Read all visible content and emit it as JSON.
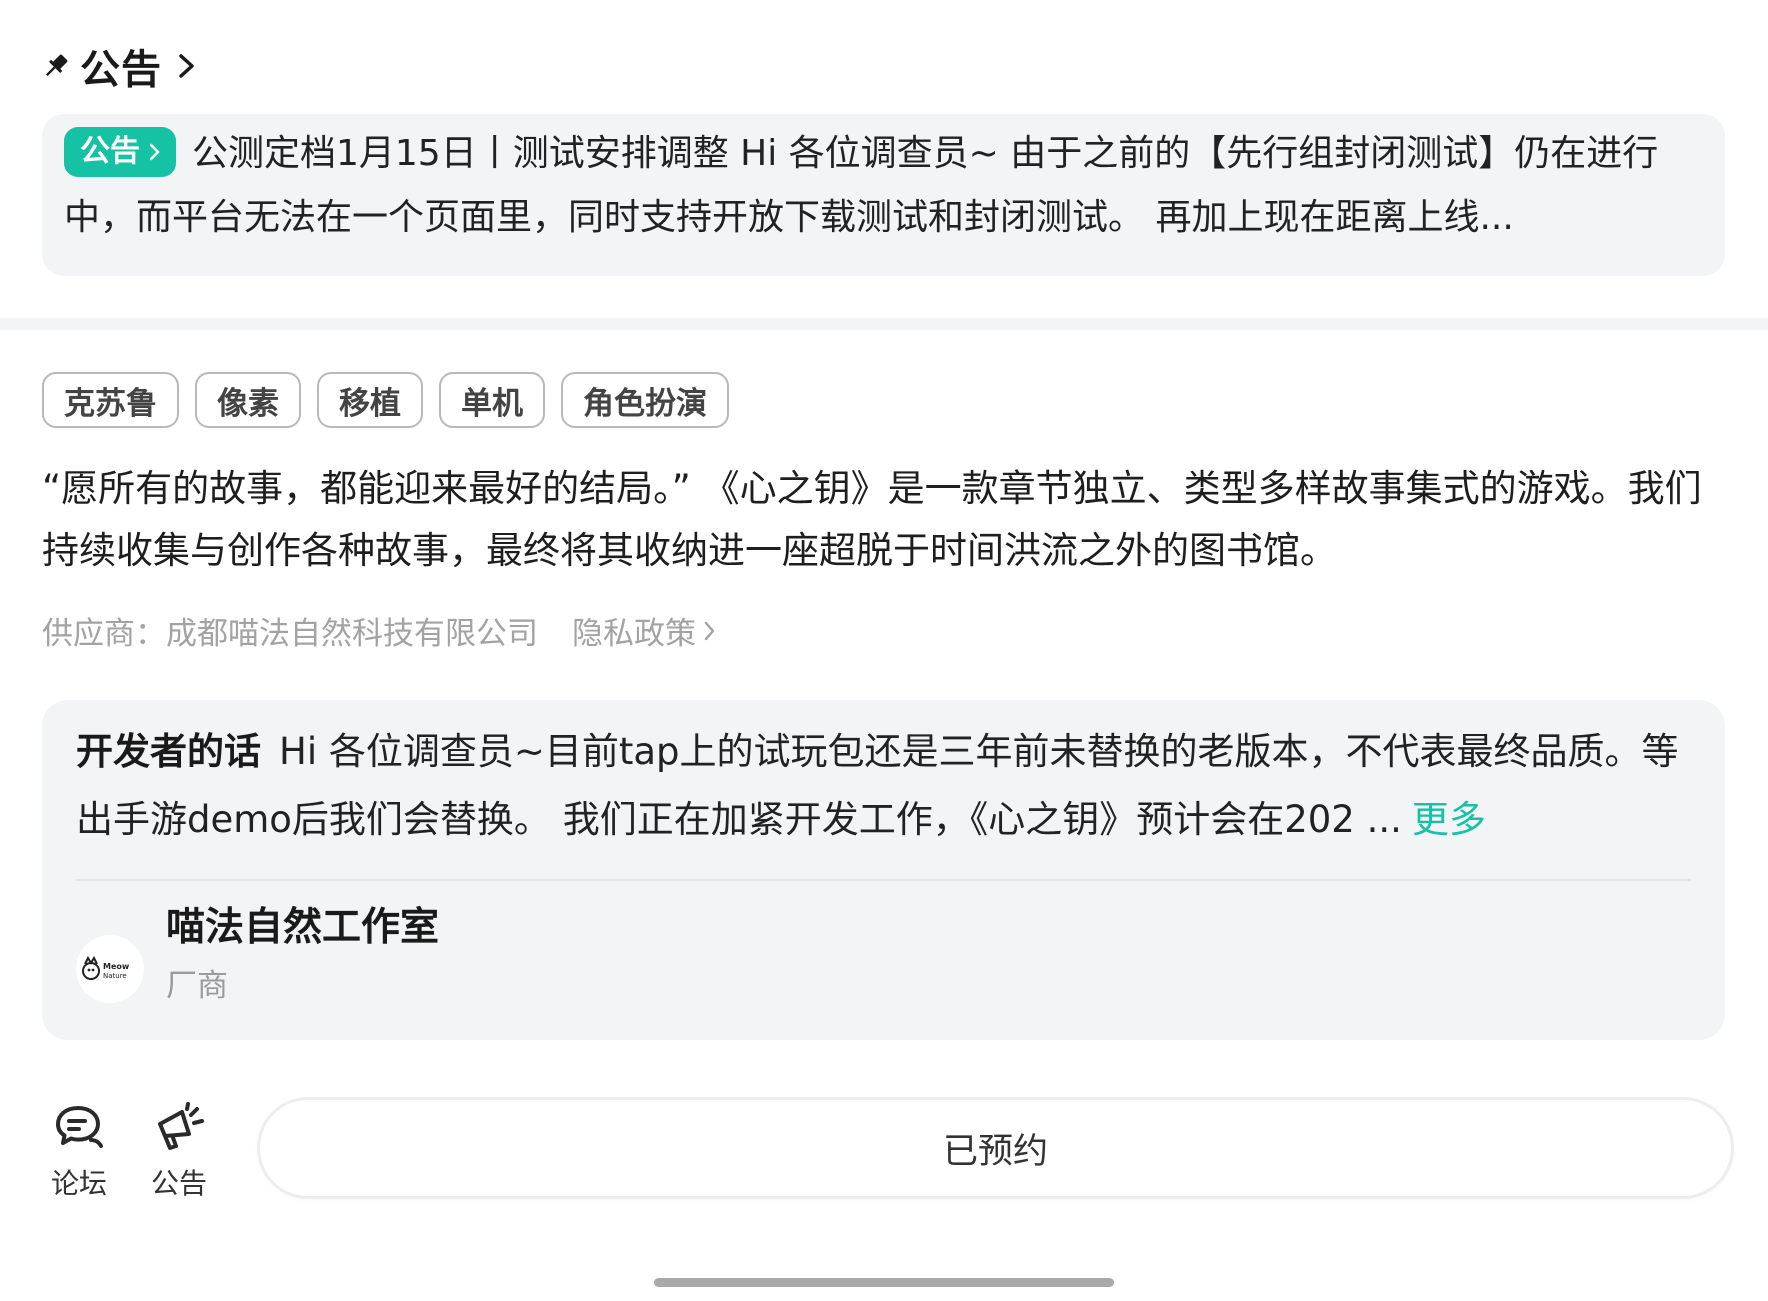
{
  "announcement": {
    "section_title": "公告",
    "badge_label": "公告",
    "text": "公测定档1月15日丨测试安排调整 Hi 各位调查员~ 由于之前的【先行组封闭测试】仍在进行中，而平台无法在一个页面里，同时支持开放下载测试和封闭测试。 再加上现在距离上线...",
    "badge_color": "#16c2a4"
  },
  "tags": [
    "克苏鲁",
    "像素",
    "移植",
    "单机",
    "角色扮演"
  ],
  "description": "“愿所有的故事，都能迎来最好的结局。” 《心之钥》是一款章节独立、类型多样故事集式的游戏。我们持续收集与创作各种故事，最终将其收纳进一座超脱于时间洪流之外的图书馆。",
  "supplier": {
    "text": "供应商：成都喵法自然科技有限公司",
    "privacy_label": "隐私政策"
  },
  "developer_note": {
    "label": "开发者的话",
    "text": "Hi 各位调查员~目前tap上的试玩包还是三年前未替换的老版本，不代表最终品质。等出手游demo后我们会替换。 我们正在加紧开发工作，《心之钥》预计会在202 ...",
    "more_label": "更多",
    "studio_name": "喵法自然工作室",
    "studio_role": "厂商",
    "logo_text": "Meow Nature"
  },
  "bottom_bar": {
    "forum_label": "论坛",
    "announcement_label": "公告",
    "reserve_label": "已预约"
  },
  "colors": {
    "accent": "#16c2a4",
    "card_bg": "#f3f4f6"
  }
}
